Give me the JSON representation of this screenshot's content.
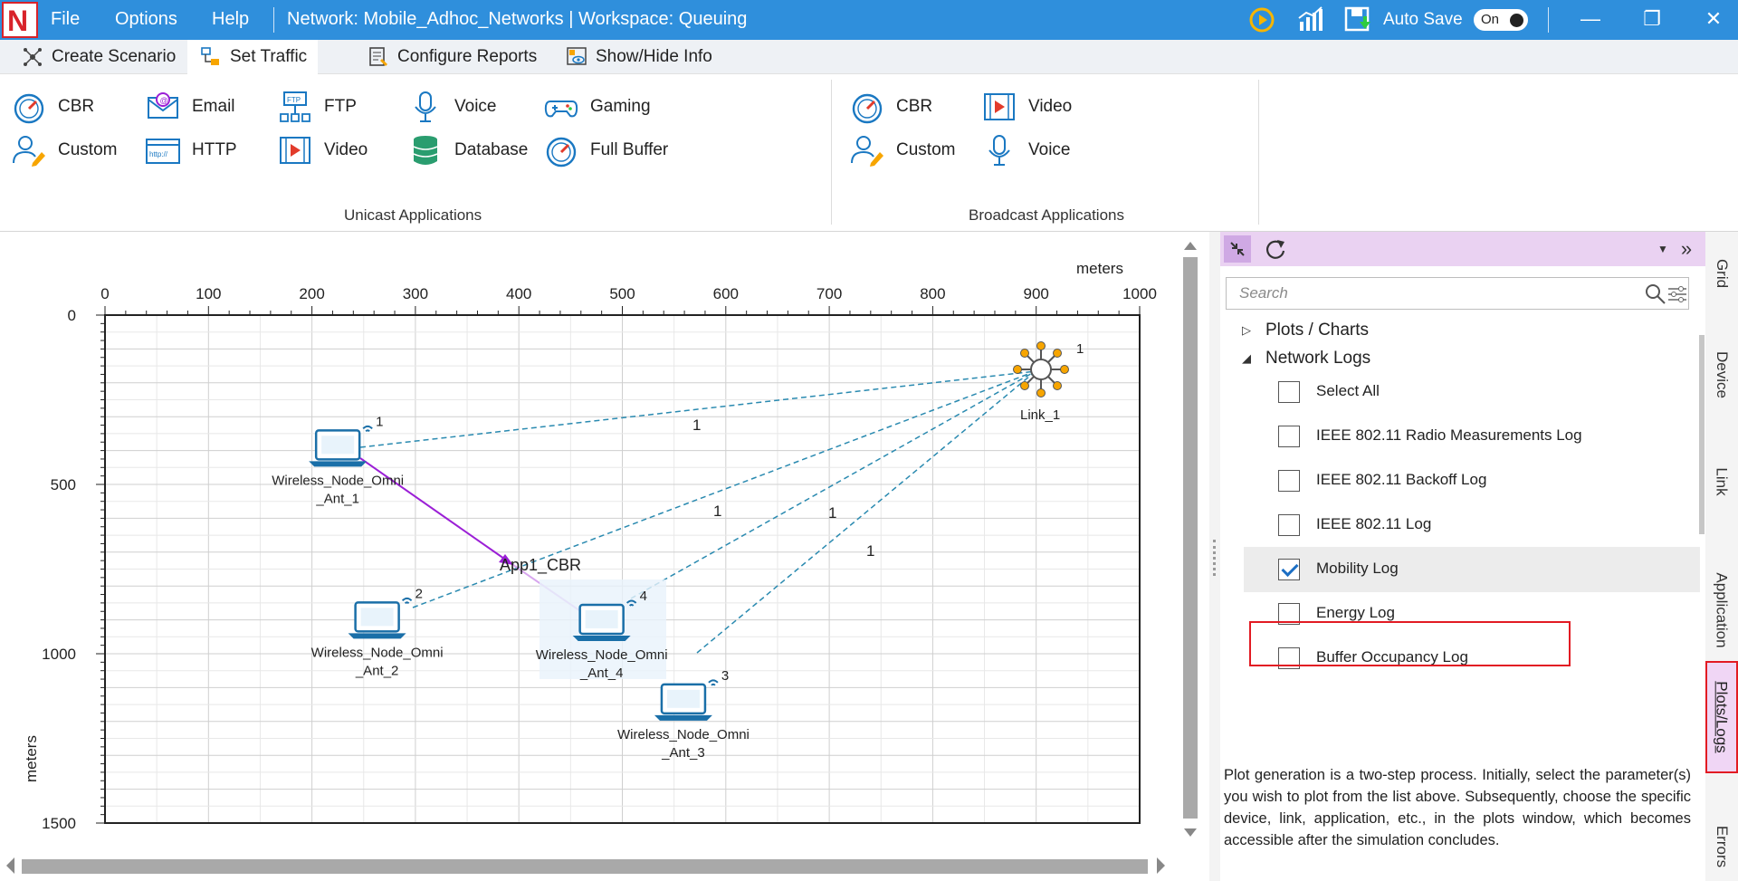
{
  "titlebar": {
    "logo": "N",
    "menu": [
      "File",
      "Options",
      "Help"
    ],
    "network_title": "Network: Mobile_Adhoc_Networks | Workspace: Queuing",
    "autosave_label": "Auto Save",
    "autosave_state": "On",
    "icons": [
      "run-icon",
      "plot-icon",
      "save-icon"
    ],
    "window_buttons": [
      "minimize-icon",
      "restore-icon",
      "close-icon"
    ]
  },
  "tabs": [
    {
      "label": "Create Scenario",
      "icon": "scenario-icon"
    },
    {
      "label": "Set Traffic",
      "icon": "traffic-icon",
      "active": true
    },
    {
      "label": "Configure Reports",
      "icon": "reports-icon"
    },
    {
      "label": "Show/Hide Info",
      "icon": "info-icon"
    }
  ],
  "ribbon": {
    "unicast": {
      "label": "Unicast Applications",
      "items": [
        {
          "label": "CBR",
          "icon": "gauge-icon"
        },
        {
          "label": "Email",
          "icon": "email-icon"
        },
        {
          "label": "FTP",
          "icon": "ftp-icon"
        },
        {
          "label": "Voice",
          "icon": "microphone-icon"
        },
        {
          "label": "Gaming",
          "icon": "gamepad-icon"
        },
        {
          "label": "Custom",
          "icon": "custom-user-icon"
        },
        {
          "label": "HTTP",
          "icon": "http-icon"
        },
        {
          "label": "Video",
          "icon": "video-icon"
        },
        {
          "label": "Database",
          "icon": "database-icon"
        },
        {
          "label": "Full Buffer",
          "icon": "gauge-icon"
        }
      ]
    },
    "broadcast": {
      "label": "Broadcast Applications",
      "items": [
        {
          "label": "CBR",
          "icon": "gauge-icon"
        },
        {
          "label": "Video",
          "icon": "video-icon"
        },
        {
          "label": "Custom",
          "icon": "custom-user-icon"
        },
        {
          "label": "Voice",
          "icon": "microphone-icon"
        }
      ]
    }
  },
  "grid": {
    "x_unit": "meters",
    "y_unit": "meters",
    "x_ticks": [
      "0",
      "100",
      "200",
      "300",
      "400",
      "500",
      "600",
      "700",
      "800",
      "900",
      "1000"
    ],
    "y_ticks": [
      "0",
      "500",
      "1000",
      "1500"
    ]
  },
  "devices": [
    {
      "name_line1": "Wireless_Node_Omni",
      "name_line2": "_Ant_1",
      "id": "1",
      "x_m": 225,
      "y_m": 410
    },
    {
      "name_line1": "Wireless_Node_Omni",
      "name_line2": "_Ant_2",
      "id": "2",
      "x_m": 263,
      "y_m": 918
    },
    {
      "name_line1": "Wireless_Node_Omni",
      "name_line2": "_Ant_4",
      "id": "4",
      "x_m": 480,
      "y_m": 925
    },
    {
      "name_line1": "Wireless_Node_Omni",
      "name_line2": "_Ant_3",
      "id": "3",
      "x_m": 559,
      "y_m": 1160
    }
  ],
  "link": {
    "name": "Link_1",
    "id": "1",
    "x_m": 900,
    "y_m": 160
  },
  "link_labels": [
    "1",
    "1",
    "1",
    "1"
  ],
  "application": {
    "label": "App1_CBR"
  },
  "panel": {
    "search_placeholder": "Search",
    "plots_node": "Plots / Charts",
    "logs_node": "Network Logs",
    "select_all": "Select All",
    "logs": [
      {
        "label": "IEEE 802.11 Radio Measurements Log",
        "checked": false
      },
      {
        "label": "IEEE 802.11 Backoff Log",
        "checked": false
      },
      {
        "label": "IEEE 802.11 Log",
        "checked": false
      },
      {
        "label": "Mobility Log",
        "checked": true
      },
      {
        "label": "Energy Log",
        "checked": false
      },
      {
        "label": "Buffer Occupancy Log",
        "checked": false
      }
    ],
    "help_text": "Plot generation is a two-step process. Initially, select the parameter(s) you wish to plot from the list above. Subsequently, choose the specific device, link, application, etc., in the plots window, which becomes accessible after the simulation concludes."
  },
  "side_tabs": [
    "Grid",
    "Device",
    "Link",
    "Application",
    "Plots/Logs",
    "Errors"
  ],
  "colors": {
    "titlebar": "#2f8fdc",
    "accent": "#1a78c2",
    "app_line": "#9b1fd6",
    "link_line": "#2a8ab0",
    "highlight": "#e21b23"
  }
}
